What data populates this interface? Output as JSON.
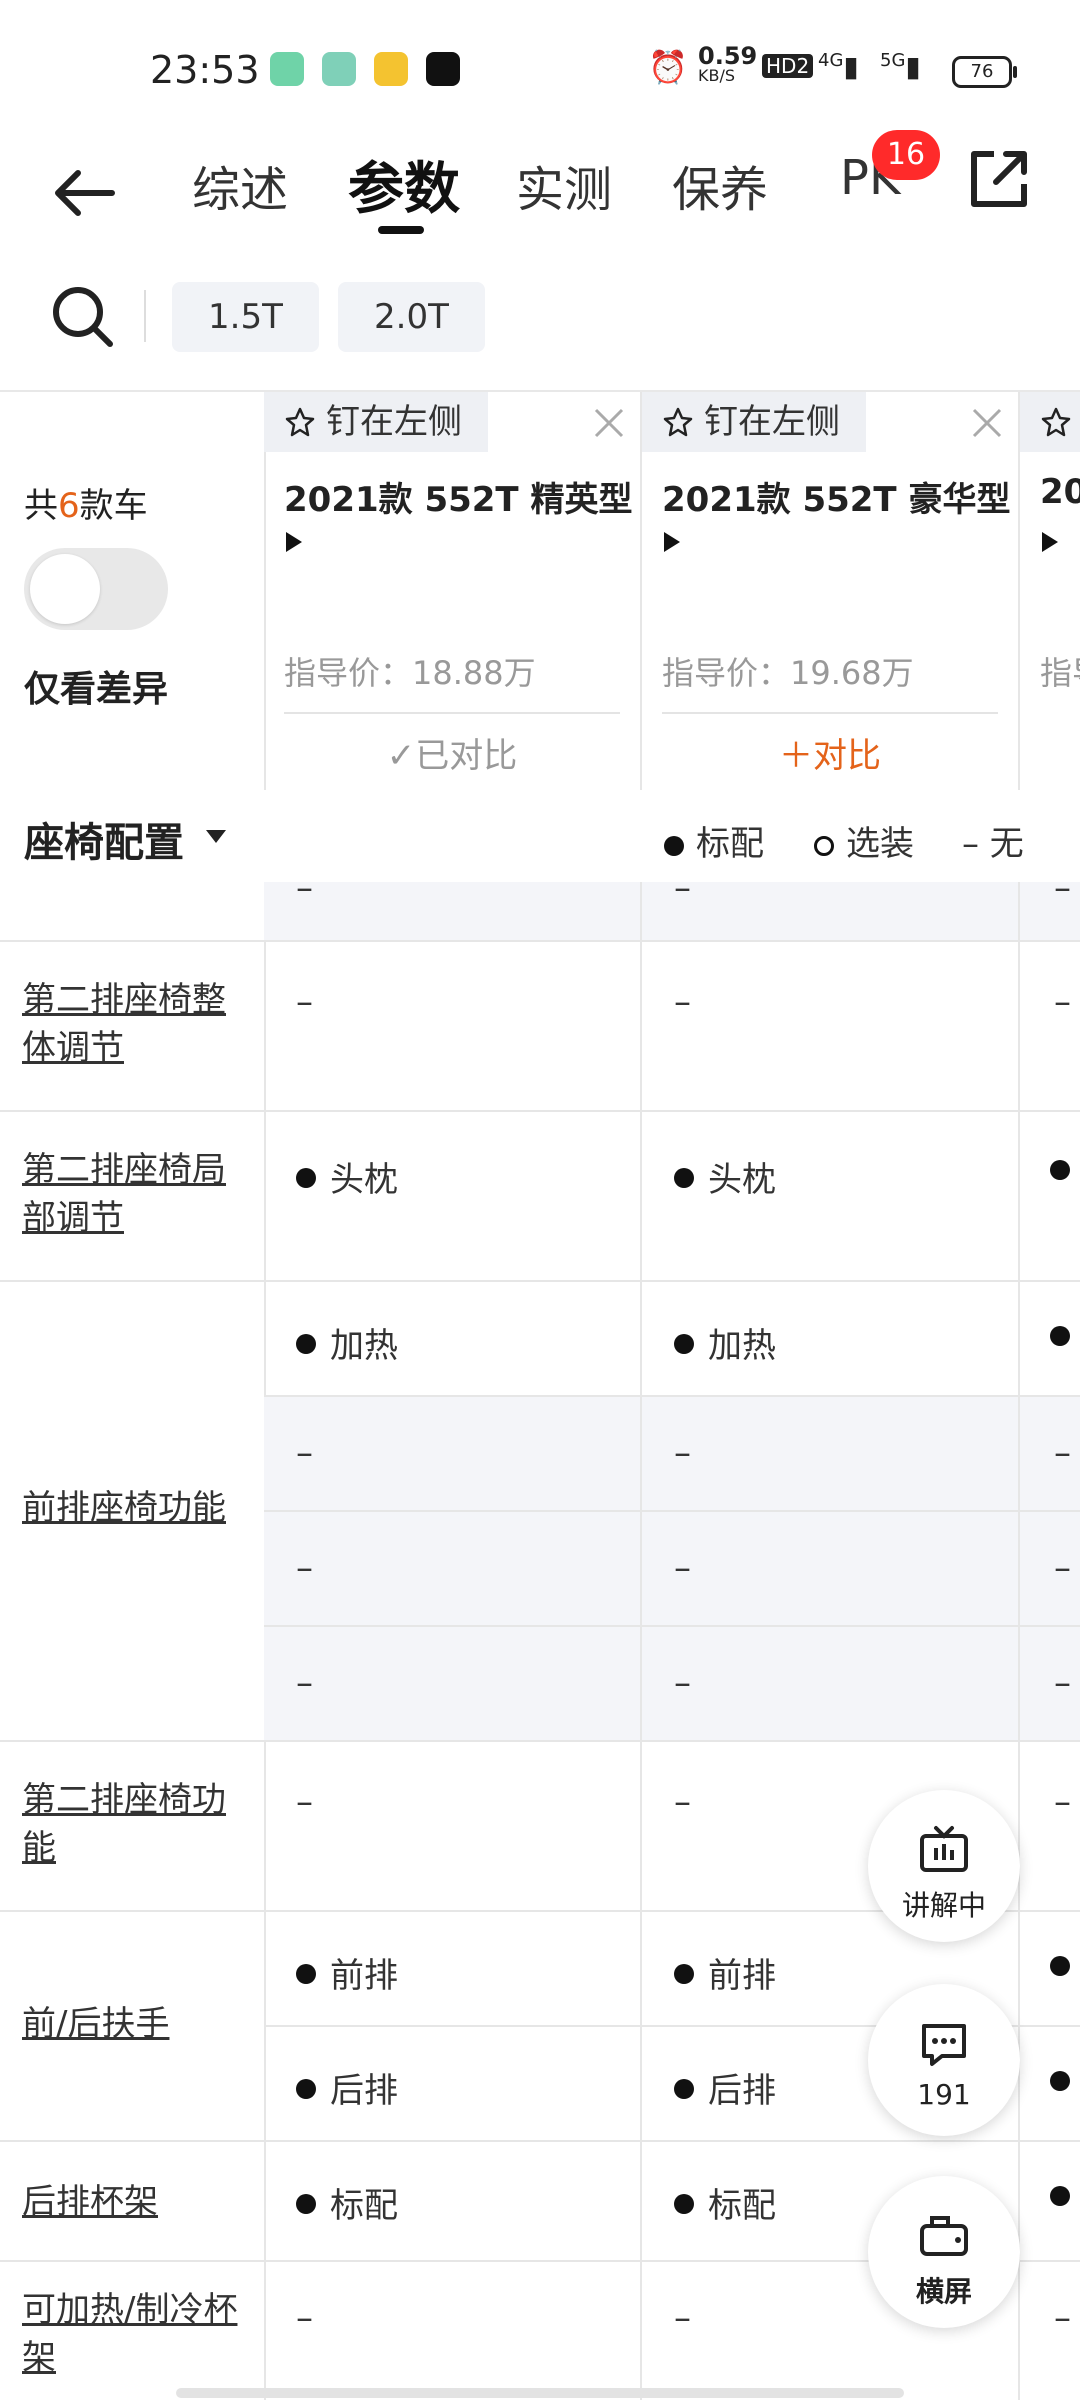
{
  "status": {
    "time": "23:53",
    "speed": "0.59",
    "speed_unit": "KB/S",
    "hd": "HD2",
    "net1": "4G",
    "net2": "5G",
    "battery": "76"
  },
  "nav": {
    "tabs": [
      "综述",
      "参数",
      "实测",
      "保养",
      "PK"
    ],
    "active_tab": "参数",
    "pk_badge": "16"
  },
  "filters": [
    "1.5T",
    "2.0T"
  ],
  "compare": {
    "total_prefix": "共",
    "total_num": "6",
    "total_suffix": "款车",
    "diff_label": "仅看差异",
    "cars": [
      {
        "pin": "钉在左侧",
        "name": "2021款 552T 精英型",
        "price": "指导价：18.88万",
        "action": "✓已对比",
        "added": true
      },
      {
        "pin": "钉在左侧",
        "name": "2021款 552T 豪华型",
        "price": "指导价：19.68万",
        "action": "＋对比",
        "added": false
      },
      {
        "pin": "",
        "name": "20",
        "price": "指导",
        "action": "",
        "added": false
      }
    ]
  },
  "section": {
    "title": "座椅配置",
    "legend": {
      "standard": "标配",
      "optional": "选装",
      "none": "– 无"
    }
  },
  "rows": [
    {
      "label": "",
      "cells": [
        [
          "–"
        ],
        [
          "–"
        ],
        [
          "–"
        ]
      ],
      "shade": true
    },
    {
      "label": "第二排座椅整体调节",
      "cells": [
        [
          "–"
        ],
        [
          "–"
        ],
        [
          "–"
        ]
      ],
      "shade": false
    },
    {
      "label": "第二排座椅局部调节",
      "cells": [
        [
          "●头枕"
        ],
        [
          "●头枕"
        ],
        [
          "●"
        ]
      ],
      "shade": false
    },
    {
      "label": "前排座椅功能",
      "sub": [
        {
          "cells": [
            "●加热",
            "●加热",
            "●"
          ],
          "shade": false
        },
        {
          "cells": [
            "–",
            "–",
            "–"
          ],
          "shade": true
        },
        {
          "cells": [
            "–",
            "–",
            "–"
          ],
          "shade": true
        },
        {
          "cells": [
            "–",
            "–",
            "–"
          ],
          "shade": true
        }
      ]
    },
    {
      "label": "第二排座椅功能",
      "cells": [
        [
          "–"
        ],
        [
          "–"
        ],
        [
          "–"
        ]
      ],
      "shade": false
    },
    {
      "label": "前/后扶手",
      "sub": [
        {
          "cells": [
            "●前排",
            "●前排",
            "●"
          ],
          "shade": false
        },
        {
          "cells": [
            "●后排",
            "●后排",
            "●"
          ],
          "shade": false
        }
      ]
    },
    {
      "label": "后排杯架",
      "cells": [
        [
          "●标配"
        ],
        [
          "●标配"
        ],
        [
          "●"
        ]
      ],
      "shade": false
    },
    {
      "label": "可加热/制冷杯架",
      "cells": [
        [
          "–"
        ],
        [
          "–"
        ],
        [
          "–"
        ]
      ],
      "shade": false
    }
  ],
  "fabs": {
    "live": "讲解中",
    "comments": "191",
    "landscape": "横屏"
  }
}
